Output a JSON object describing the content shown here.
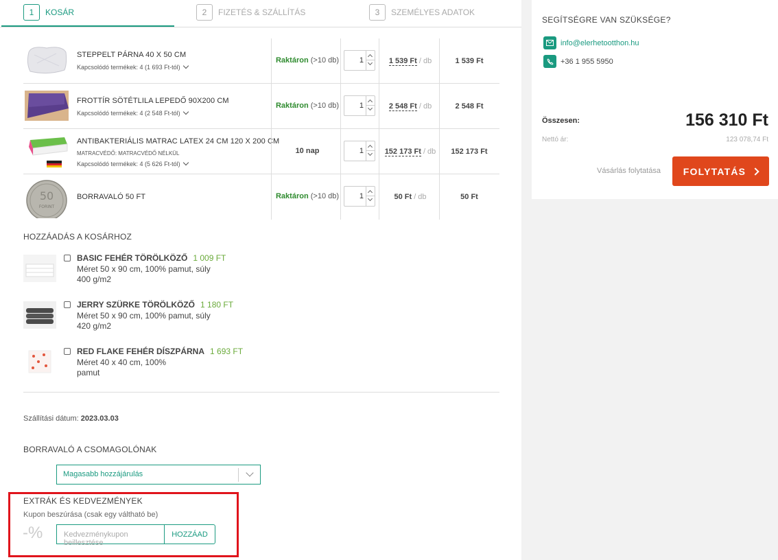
{
  "steps": [
    {
      "num": "1",
      "label": "KOSÁR"
    },
    {
      "num": "2",
      "label": "FIZETÉS & SZÁLLÍTÁS"
    },
    {
      "num": "3",
      "label": "SZEMÉLYES ADATOK"
    }
  ],
  "cart": [
    {
      "name": "STEPPELT PÁRNA 40 X 50 CM",
      "related": "Kapcsolódó termékek: 4 (1 693 Ft-tól)",
      "stock_label": "Raktáron",
      "stock_qty": "(>10 db)",
      "qty": "1",
      "unit_price": "1 539 Ft",
      "unit": " / db",
      "total": "1 539 Ft"
    },
    {
      "name": "FROTTÍR SÖTÉTLILA LEPEDŐ 90X200 CM",
      "related": "Kapcsolódó termékek: 4 (2 548 Ft-tól)",
      "stock_label": "Raktáron",
      "stock_qty": "(>10 db)",
      "qty": "1",
      "unit_price": "2 548 Ft",
      "unit": " / db",
      "total": "2 548 Ft"
    },
    {
      "name": "ANTIBAKTERIÁLIS MATRAC LATEX 24 CM 120 X 200 CM",
      "option": "MATRACVÉDŐ: MATRACVÉDŐ NÉLKÜL",
      "related": "Kapcsolódó termékek: 4 (5 626 Ft-tól)",
      "delivery": "10 nap",
      "qty": "1",
      "unit_price": "152 173 Ft",
      "unit": " / db",
      "total": "152 173 Ft"
    },
    {
      "name": "BORRAVALÓ 50 FT",
      "stock_label": "Raktáron",
      "stock_qty": "(>10 db)",
      "qty": "1",
      "unit_price": "50 Ft",
      "unit": " / db",
      "total": "50 Ft"
    }
  ],
  "addons_title": "HOZZÁADÁS A KOSÁRHOZ",
  "addons": [
    {
      "name": "BASIC FEHÉR TÖRÖLKÖZŐ",
      "price": "1 009 Ft",
      "desc": "Méret 50 x 90 cm, 100% pamut, súly 400 g/m2"
    },
    {
      "name": "JERRY SZÜRKE TÖRÖLKÖZŐ",
      "price": "1 180 Ft",
      "desc": "Méret 50 x 90 cm, 100% pamut, súly 420 g/m2"
    },
    {
      "name": "RED FLAKE FEHÉR DÍSZPÁRNA",
      "price": "1 693 Ft",
      "desc": "Méret 40 x 40 cm, 100% pamut"
    }
  ],
  "shipping": {
    "label": "Szállítási dátum:",
    "date": "2023.03.03"
  },
  "tip": {
    "title": "BORRAVALÓ A CSOMAGOLÓNAK",
    "selected": "Magasabb hozzájárulás"
  },
  "extras": {
    "title": "EXTRÁK ÉS KEDVEZMÉNYEK",
    "coupon_label": "Kupon beszúrása (csak egy váltható be)",
    "percent_symbol": "-%",
    "coupon_placeholder": "Kedvezménykupon beillesztése",
    "coupon_button": "HOZZÁAD"
  },
  "summary": {
    "help_title": "SEGÍTSÉGRE VAN SZÜKSÉGE?",
    "email": "info@elerhetootthon.hu",
    "phone": "+36 1 955 5950",
    "total_label": "Összesen:",
    "total_value": "156 310 Ft",
    "netto_label": "Nettó ár:",
    "netto_value": "123 078,74 Ft",
    "continue_link": "Vásárlás folytatása",
    "continue_button": "FOLYTATÁS"
  },
  "colors": {
    "accent": "#1a9a80",
    "cta": "#e0471c",
    "stock": "#2e8b2e",
    "addon_price": "#6aaa3a",
    "highlight": "#e0141c"
  }
}
